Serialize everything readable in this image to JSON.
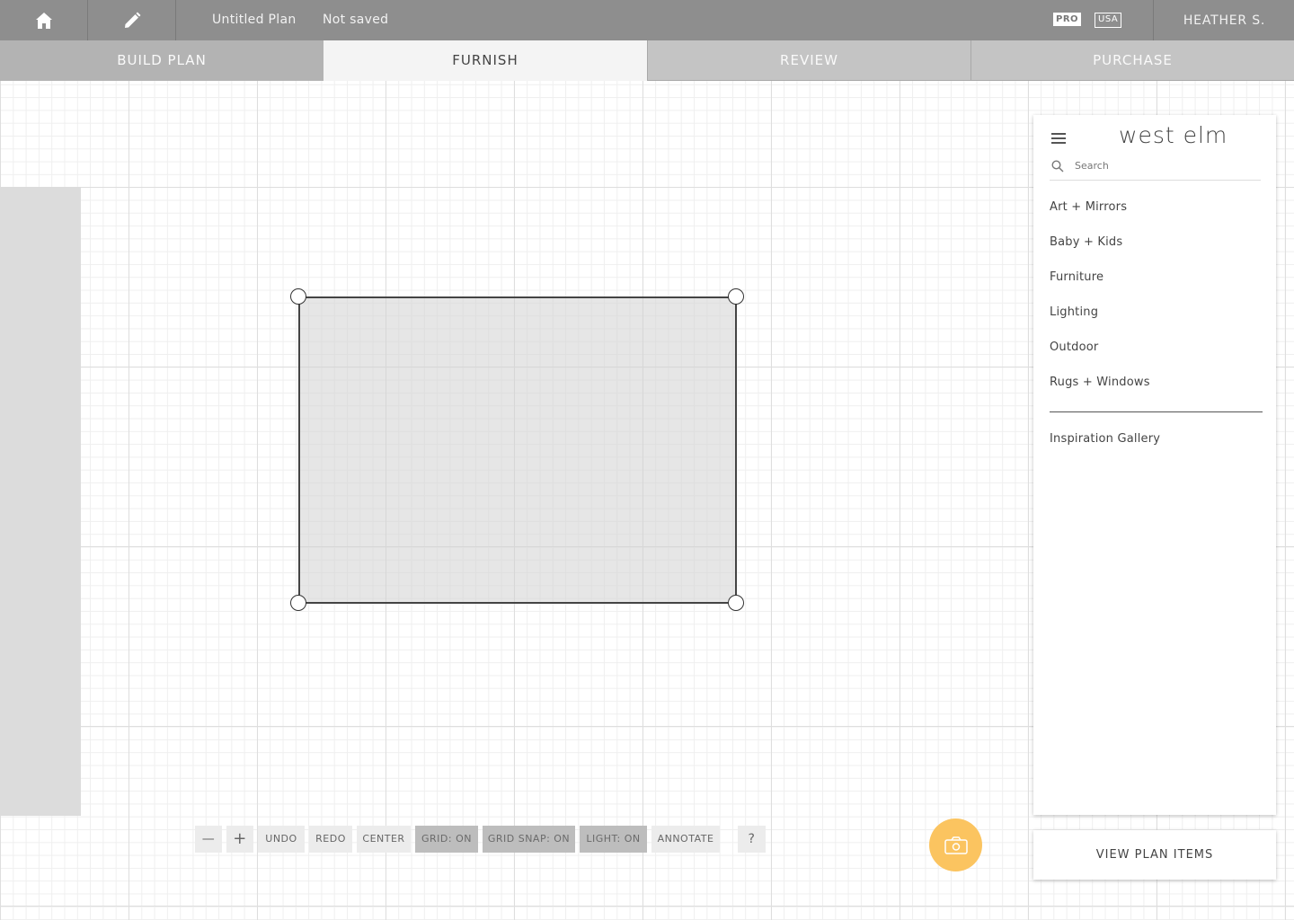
{
  "header": {
    "plan_name": "Untitled Plan",
    "save_status": "Not saved",
    "pro_badge": "PRO",
    "region_badge": "USA",
    "user_name": "HEATHER S."
  },
  "tabs": [
    {
      "label": "BUILD PLAN"
    },
    {
      "label": "FURNISH"
    },
    {
      "label": "REVIEW"
    },
    {
      "label": "PURCHASE"
    }
  ],
  "sidebar": {
    "brand": "west elm",
    "search_placeholder": "Search",
    "categories": [
      {
        "label": "Art + Mirrors"
      },
      {
        "label": "Baby + Kids"
      },
      {
        "label": "Furniture"
      },
      {
        "label": "Lighting"
      },
      {
        "label": "Outdoor"
      },
      {
        "label": "Rugs + Windows"
      }
    ],
    "gallery_link": "Inspiration Gallery"
  },
  "toolbar": {
    "zoom_out": "—",
    "zoom_in": "+",
    "undo": "UNDO",
    "redo": "REDO",
    "center": "CENTER",
    "grid": "GRID: ON",
    "grid_snap": "GRID SNAP: ON",
    "light": "LIGHT: ON",
    "annotate": "ANNOTATE",
    "help": "?"
  },
  "view_plan_items": "VIEW PLAN ITEMS",
  "colors": {
    "topbar": "#8e8e8e",
    "active_tab": "#f4f4f4",
    "camera_button": "#fbc460"
  }
}
